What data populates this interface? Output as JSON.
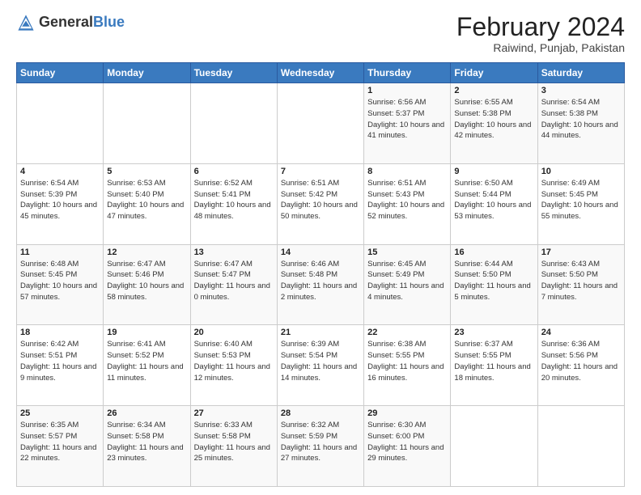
{
  "header": {
    "logo_general": "General",
    "logo_blue": "Blue",
    "month_title": "February 2024",
    "location": "Raiwind, Punjab, Pakistan"
  },
  "days_of_week": [
    "Sunday",
    "Monday",
    "Tuesday",
    "Wednesday",
    "Thursday",
    "Friday",
    "Saturday"
  ],
  "weeks": [
    [
      {
        "day": "",
        "info": ""
      },
      {
        "day": "",
        "info": ""
      },
      {
        "day": "",
        "info": ""
      },
      {
        "day": "",
        "info": ""
      },
      {
        "day": "1",
        "info": "Sunrise: 6:56 AM\nSunset: 5:37 PM\nDaylight: 10 hours and 41 minutes."
      },
      {
        "day": "2",
        "info": "Sunrise: 6:55 AM\nSunset: 5:38 PM\nDaylight: 10 hours and 42 minutes."
      },
      {
        "day": "3",
        "info": "Sunrise: 6:54 AM\nSunset: 5:38 PM\nDaylight: 10 hours and 44 minutes."
      }
    ],
    [
      {
        "day": "4",
        "info": "Sunrise: 6:54 AM\nSunset: 5:39 PM\nDaylight: 10 hours and 45 minutes."
      },
      {
        "day": "5",
        "info": "Sunrise: 6:53 AM\nSunset: 5:40 PM\nDaylight: 10 hours and 47 minutes."
      },
      {
        "day": "6",
        "info": "Sunrise: 6:52 AM\nSunset: 5:41 PM\nDaylight: 10 hours and 48 minutes."
      },
      {
        "day": "7",
        "info": "Sunrise: 6:51 AM\nSunset: 5:42 PM\nDaylight: 10 hours and 50 minutes."
      },
      {
        "day": "8",
        "info": "Sunrise: 6:51 AM\nSunset: 5:43 PM\nDaylight: 10 hours and 52 minutes."
      },
      {
        "day": "9",
        "info": "Sunrise: 6:50 AM\nSunset: 5:44 PM\nDaylight: 10 hours and 53 minutes."
      },
      {
        "day": "10",
        "info": "Sunrise: 6:49 AM\nSunset: 5:45 PM\nDaylight: 10 hours and 55 minutes."
      }
    ],
    [
      {
        "day": "11",
        "info": "Sunrise: 6:48 AM\nSunset: 5:45 PM\nDaylight: 10 hours and 57 minutes."
      },
      {
        "day": "12",
        "info": "Sunrise: 6:47 AM\nSunset: 5:46 PM\nDaylight: 10 hours and 58 minutes."
      },
      {
        "day": "13",
        "info": "Sunrise: 6:47 AM\nSunset: 5:47 PM\nDaylight: 11 hours and 0 minutes."
      },
      {
        "day": "14",
        "info": "Sunrise: 6:46 AM\nSunset: 5:48 PM\nDaylight: 11 hours and 2 minutes."
      },
      {
        "day": "15",
        "info": "Sunrise: 6:45 AM\nSunset: 5:49 PM\nDaylight: 11 hours and 4 minutes."
      },
      {
        "day": "16",
        "info": "Sunrise: 6:44 AM\nSunset: 5:50 PM\nDaylight: 11 hours and 5 minutes."
      },
      {
        "day": "17",
        "info": "Sunrise: 6:43 AM\nSunset: 5:50 PM\nDaylight: 11 hours and 7 minutes."
      }
    ],
    [
      {
        "day": "18",
        "info": "Sunrise: 6:42 AM\nSunset: 5:51 PM\nDaylight: 11 hours and 9 minutes."
      },
      {
        "day": "19",
        "info": "Sunrise: 6:41 AM\nSunset: 5:52 PM\nDaylight: 11 hours and 11 minutes."
      },
      {
        "day": "20",
        "info": "Sunrise: 6:40 AM\nSunset: 5:53 PM\nDaylight: 11 hours and 12 minutes."
      },
      {
        "day": "21",
        "info": "Sunrise: 6:39 AM\nSunset: 5:54 PM\nDaylight: 11 hours and 14 minutes."
      },
      {
        "day": "22",
        "info": "Sunrise: 6:38 AM\nSunset: 5:55 PM\nDaylight: 11 hours and 16 minutes."
      },
      {
        "day": "23",
        "info": "Sunrise: 6:37 AM\nSunset: 5:55 PM\nDaylight: 11 hours and 18 minutes."
      },
      {
        "day": "24",
        "info": "Sunrise: 6:36 AM\nSunset: 5:56 PM\nDaylight: 11 hours and 20 minutes."
      }
    ],
    [
      {
        "day": "25",
        "info": "Sunrise: 6:35 AM\nSunset: 5:57 PM\nDaylight: 11 hours and 22 minutes."
      },
      {
        "day": "26",
        "info": "Sunrise: 6:34 AM\nSunset: 5:58 PM\nDaylight: 11 hours and 23 minutes."
      },
      {
        "day": "27",
        "info": "Sunrise: 6:33 AM\nSunset: 5:58 PM\nDaylight: 11 hours and 25 minutes."
      },
      {
        "day": "28",
        "info": "Sunrise: 6:32 AM\nSunset: 5:59 PM\nDaylight: 11 hours and 27 minutes."
      },
      {
        "day": "29",
        "info": "Sunrise: 6:30 AM\nSunset: 6:00 PM\nDaylight: 11 hours and 29 minutes."
      },
      {
        "day": "",
        "info": ""
      },
      {
        "day": "",
        "info": ""
      }
    ]
  ]
}
